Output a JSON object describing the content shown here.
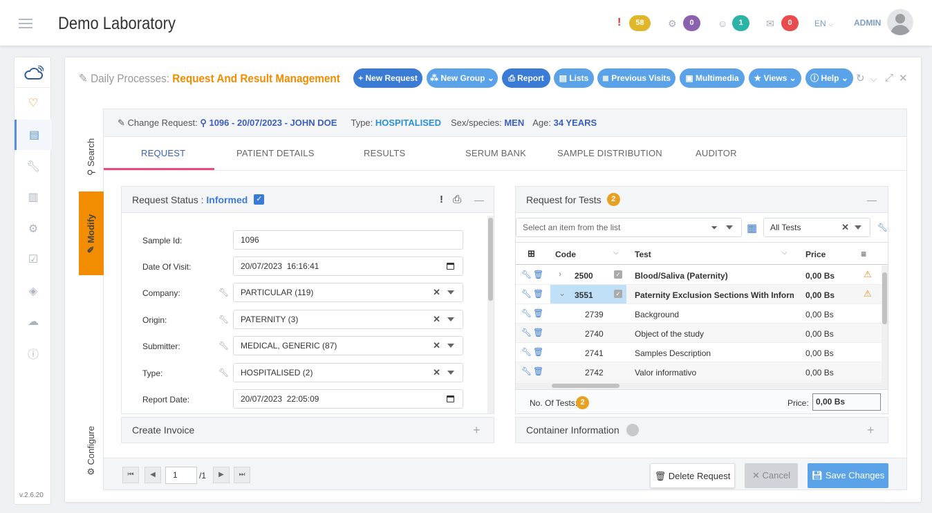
{
  "app": {
    "title": "Demo Laboratory",
    "version": "v.2.6.20",
    "language": "EN",
    "user": "ADMIN"
  },
  "topbar": {
    "badges": [
      {
        "icon": "exclamation-icon",
        "count": "58",
        "color": "#e0b72a"
      },
      {
        "icon": "cogs-icon",
        "count": "0",
        "color": "#8a62b0"
      },
      {
        "icon": "users-icon",
        "count": "1",
        "color": "#2bb3a5"
      },
      {
        "icon": "envelope-icon",
        "count": "0",
        "color": "#e84c4c"
      }
    ]
  },
  "page": {
    "title_prefix": "Daily Processes:",
    "title": "Request And Result Management"
  },
  "toolbar": {
    "new_request": "New Request",
    "new_group": "New Group",
    "report": "Report",
    "lists": "Lists",
    "previous_visits": "Previous Visits",
    "multimedia": "Multimedia",
    "views": "Views",
    "help": "Help"
  },
  "vtabs": {
    "search": "Search",
    "modify": "Modify",
    "configure": "Configure"
  },
  "request": {
    "change_label": "Change Request:",
    "id": "1096 - 20/07/2023 - JOHN DOE",
    "type_label": "Type:",
    "type": "HOSPITALISED",
    "sex_label": "Sex/species:",
    "sex": "MEN",
    "age_label": "Age:",
    "age": "34 YEARS"
  },
  "tabs": [
    "REQUEST",
    "PATIENT DETAILS",
    "RESULTS",
    "SERUM BANK",
    "SAMPLE DISTRIBUTION",
    "AUDITOR"
  ],
  "status": {
    "label": "Request Status :",
    "value": "Informed"
  },
  "form": [
    {
      "label": "Sample Id:",
      "value": "1096",
      "kind": "text"
    },
    {
      "label": "Date Of Visit:",
      "value": "20/07/2023  16:16:41",
      "kind": "date"
    },
    {
      "label": "Company:",
      "value": "PARTICULAR (119)",
      "kind": "select"
    },
    {
      "label": "Origin:",
      "value": "PATERNITY (3)",
      "kind": "select"
    },
    {
      "label": "Submitter:",
      "value": "MEDICAL, GENERIC (87)",
      "kind": "select"
    },
    {
      "label": "Type:",
      "value": "HOSPITALISED (2)",
      "kind": "select"
    },
    {
      "label": "Report Date:",
      "value": "20/07/2023  22:05:09",
      "kind": "date"
    }
  ],
  "invoice": {
    "title": "Create Invoice"
  },
  "tests": {
    "title": "Request for Tests",
    "count": "2",
    "filter_placeholder": "Select an item from the list",
    "filter_all": "All Tests",
    "columns": {
      "code": "Code",
      "test": "Test",
      "price": "Price"
    },
    "rows": [
      {
        "code": "2500",
        "test": "Blood/Saliva (Paternity)",
        "price": "0,00 Bs",
        "bold": true,
        "expander": "›",
        "warn": true
      },
      {
        "code": "3551",
        "test": "Paternity Exclusion Sections With Informativ...",
        "price": "0,00 Bs",
        "bold": true,
        "expander": "⌄",
        "warn": true,
        "selected": true
      },
      {
        "code": "2739",
        "test": "Background",
        "price": "0,00 Bs",
        "bold": false
      },
      {
        "code": "2740",
        "test": "Object of the study",
        "price": "0,00 Bs",
        "bold": false
      },
      {
        "code": "2741",
        "test": "Samples Description",
        "price": "0,00 Bs",
        "bold": false
      },
      {
        "code": "2742",
        "test": "Valor informativo",
        "price": "0,00 Bs",
        "bold": false
      }
    ],
    "no_tests_label": "No. Of Tests:",
    "price_label": "Price:",
    "price_total": "0,00 Bs"
  },
  "container": {
    "title": "Container Information"
  },
  "pager": {
    "page": "1",
    "total": "/1"
  },
  "actions": {
    "delete": "Delete Request",
    "cancel": "Cancel",
    "save": "Save Changes"
  }
}
